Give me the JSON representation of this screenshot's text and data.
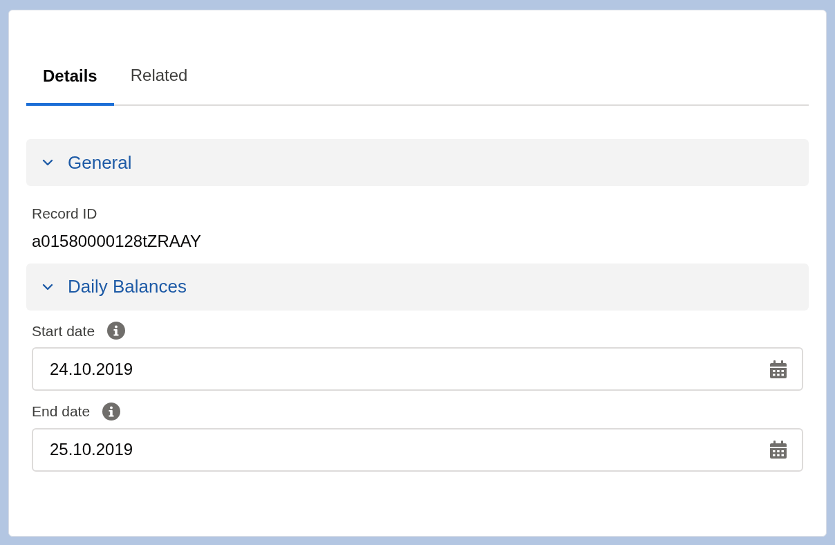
{
  "tabs": [
    {
      "label": "Details",
      "selected": true
    },
    {
      "label": "Related",
      "selected": false
    }
  ],
  "sections": [
    {
      "title": "General",
      "expanded": true,
      "fields": [
        {
          "kind": "output",
          "label": "Record ID",
          "value": "a01580000128tZRAAY"
        }
      ]
    },
    {
      "title": "Daily Balances",
      "expanded": true,
      "fields": [
        {
          "kind": "date",
          "label": "Start date",
          "value": "24.10.2019"
        },
        {
          "kind": "date",
          "label": "End date",
          "value": "25.10.2019"
        }
      ]
    }
  ]
}
